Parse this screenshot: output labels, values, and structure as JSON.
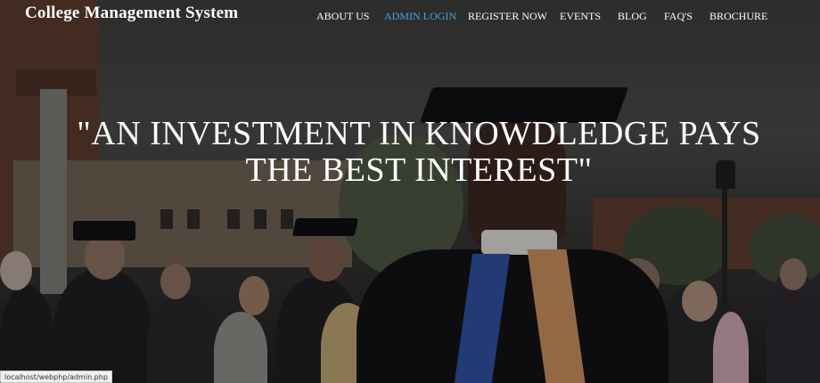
{
  "header": {
    "brand": "College Management System"
  },
  "nav": {
    "items": [
      {
        "label": "ABOUT US",
        "active": false
      },
      {
        "label": "ADMIN LOGIN",
        "active": true
      },
      {
        "label": "REGISTER NOW",
        "active": false
      },
      {
        "label": "EVENTS",
        "active": false
      },
      {
        "label": "BLOG",
        "active": false
      },
      {
        "label": "FAQ'S",
        "active": false
      },
      {
        "label": "BROCHURE",
        "active": false
      }
    ],
    "active_color": "#4aa3df"
  },
  "hero": {
    "quote_line1": "\"AN INVESTMENT IN KNOWDLEDGE PAYS",
    "quote_line2": "THE BEST INTEREST\""
  },
  "status_bar": {
    "url": "localhost/webphp/admin.php"
  }
}
